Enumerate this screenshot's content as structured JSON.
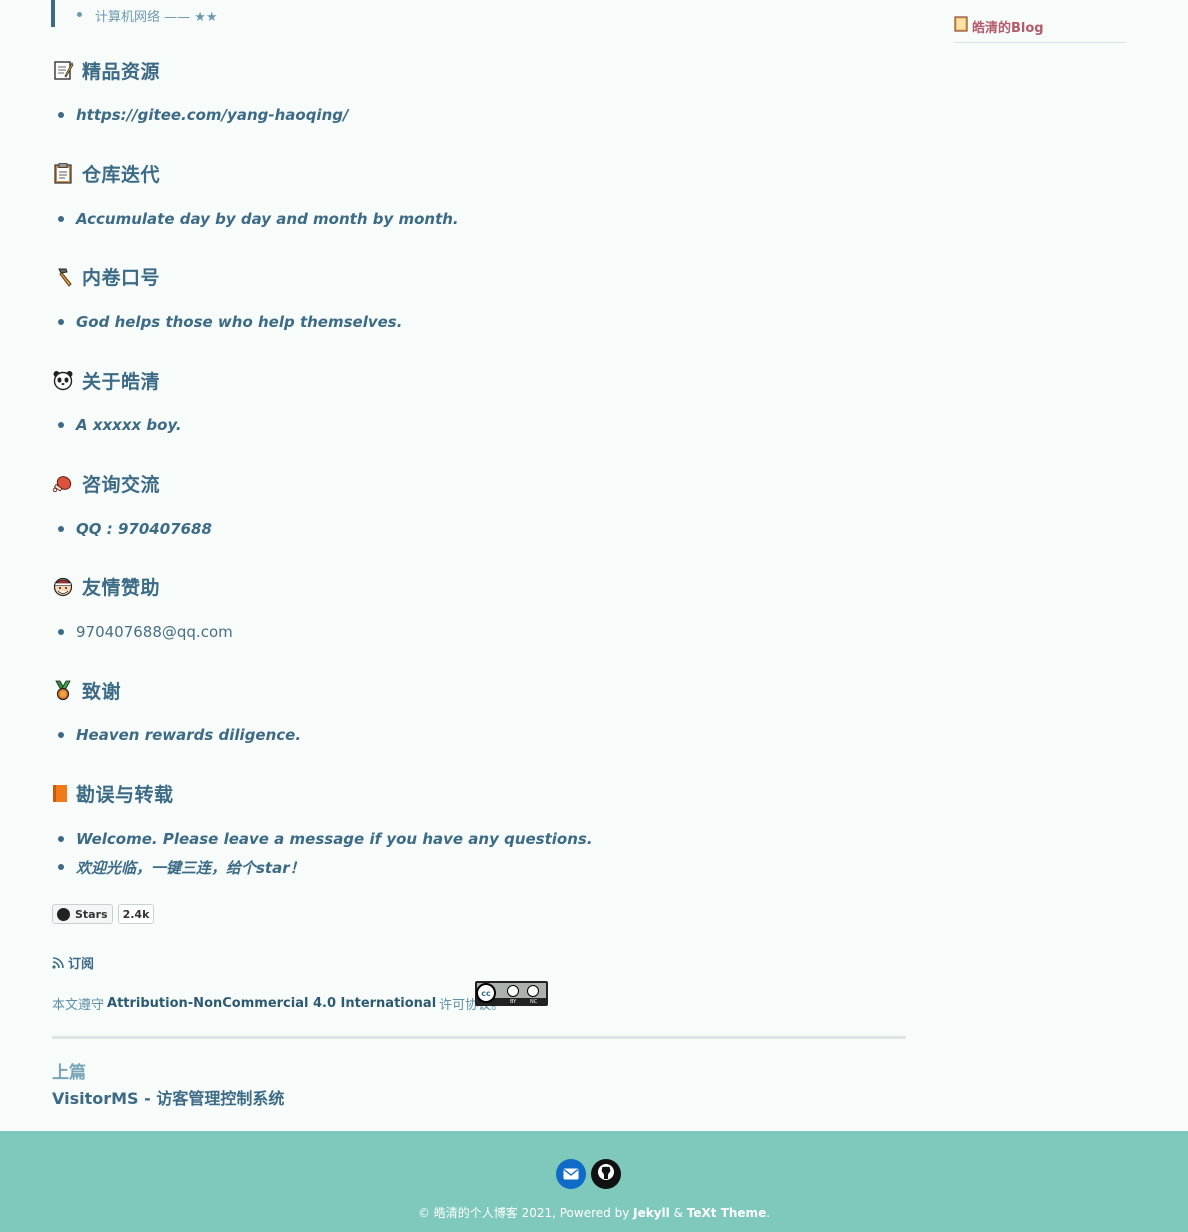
{
  "blockquote": {
    "item": "计算机网络 —— ★★"
  },
  "sections": [
    {
      "title": "精品资源",
      "icon": "memo-icon",
      "item": "https://gitee.com/yang-haoqing/"
    },
    {
      "title": "仓库迭代",
      "icon": "clipboard-icon",
      "item": "Accumulate day by day and month by month."
    },
    {
      "title": "内卷口号",
      "icon": "hammer-icon",
      "item": "God helps those who help themselves."
    },
    {
      "title": "关于皓清",
      "icon": "panda-icon",
      "item": "A xxxxx boy."
    },
    {
      "title": "咨询交流",
      "icon": "meat-icon",
      "item": "QQ : 970407688"
    },
    {
      "title": "友情赞助",
      "icon": "santa-icon",
      "item": "970407688@qq.com"
    },
    {
      "title": "致谢",
      "icon": "medal-icon",
      "item": "Heaven rewards diligence."
    },
    {
      "title": "勘误与转载",
      "icon": "book-icon",
      "items": [
        "Welcome. Please leave a message if you have any questions.",
        "欢迎光临，一键三连，给个star！"
      ]
    }
  ],
  "github_badge": {
    "label": "Stars",
    "count": "2.4k"
  },
  "rss": {
    "label": "订阅"
  },
  "license": {
    "prefix": "本文遵守",
    "name": "Attribution-NonCommercial 4.0 International",
    "suffix": "许可协议。",
    "cc_labels": [
      "BY",
      "NC"
    ]
  },
  "pagination": {
    "prev_label": "上篇",
    "prev_title": "VisitorMS - 访客管理控制系统"
  },
  "sidebar": {
    "title": "皓清的Blog"
  },
  "footer": {
    "prefix": "© 皓清的个人博客 2021, Powered by",
    "jekyll": "Jekyll",
    "amp": "&",
    "theme": "TeXt Theme",
    "period": "."
  }
}
